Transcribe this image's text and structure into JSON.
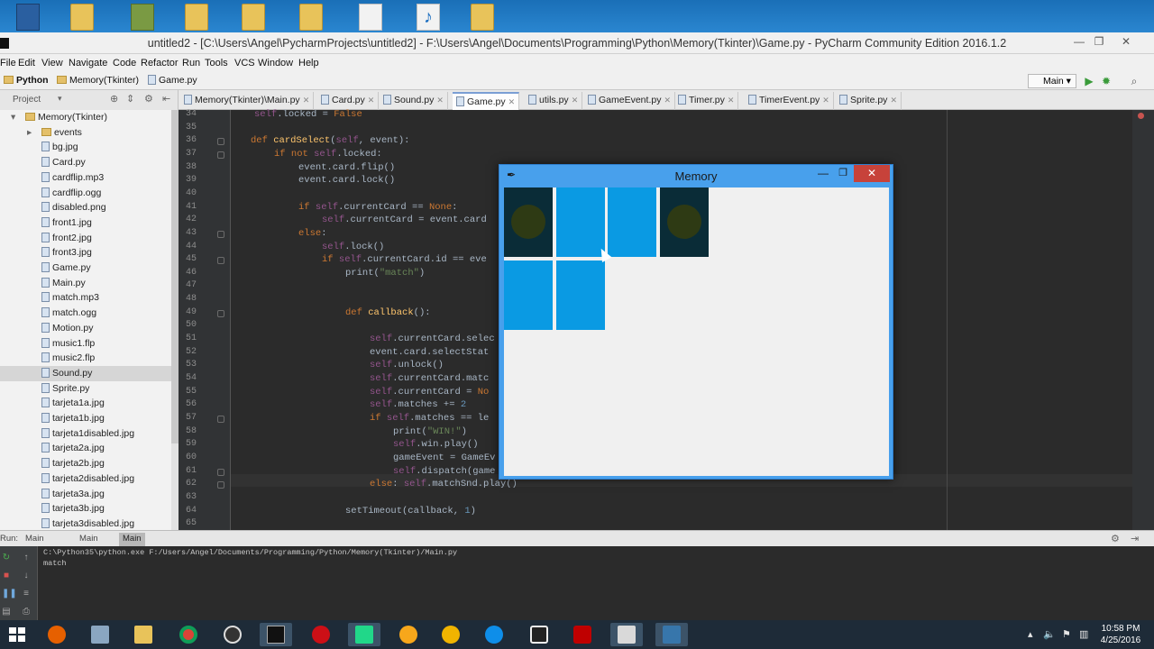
{
  "window": {
    "title": "untitled2 - [C:\\Users\\Angel\\PycharmProjects\\untitled2] - F:\\Users\\Angel\\Documents\\Programming\\Python\\Memory(Tkinter)\\Game.py - PyCharm Community Edition 2016.1.2"
  },
  "menu": [
    "File",
    "Edit",
    "View",
    "Navigate",
    "Code",
    "Refactor",
    "Run",
    "Tools",
    "VCS",
    "Window",
    "Help"
  ],
  "breadcrumb": [
    "Python",
    "Memory(Tkinter)",
    "Game.py"
  ],
  "run_config": "Main",
  "project_label": "Project",
  "tabs": [
    "Memory(Tkinter)\\Main.py",
    "Card.py",
    "Sound.py",
    "Game.py",
    "utils.py",
    "GameEvent.py",
    "Timer.py",
    "TimerEvent.py",
    "Sprite.py"
  ],
  "active_tab": "Game.py",
  "tree": {
    "root": "Memory(Tkinter)",
    "items": [
      "events",
      "bg.jpg",
      "Card.py",
      "cardflip.mp3",
      "cardflip.ogg",
      "disabled.png",
      "front1.jpg",
      "front2.jpg",
      "front3.jpg",
      "Game.py",
      "Main.py",
      "match.mp3",
      "match.ogg",
      "Motion.py",
      "music1.flp",
      "music2.flp",
      "Sound.py",
      "Sprite.py",
      "tarjeta1a.jpg",
      "tarjeta1b.jpg",
      "tarjeta1disabled.jpg",
      "tarjeta2a.jpg",
      "tarjeta2b.jpg",
      "tarjeta2disabled.jpg",
      "tarjeta3a.jpg",
      "tarjeta3b.jpg",
      "tarjeta3disabled.jpg"
    ],
    "selected": "Sound.py"
  },
  "line_numbers": [
    "34",
    "35",
    "36",
    "37",
    "38",
    "39",
    "40",
    "41",
    "42",
    "43",
    "44",
    "45",
    "46",
    "47",
    "48",
    "49",
    "50",
    "51",
    "52",
    "53",
    "54",
    "55",
    "56",
    "57",
    "58",
    "59",
    "60",
    "61",
    "62",
    "63",
    "64",
    "65"
  ],
  "run_panel": {
    "label": "Run:",
    "tabs": [
      "Main",
      "Main",
      "Main"
    ],
    "command": "C:\\Python35\\python.exe F:/Users/Angel/Documents/Programming/Python/Memory(Tkinter)/Main.py",
    "output": "match"
  },
  "tk_window": {
    "title": "Memory",
    "cards_state": [
      "front",
      "back",
      "back",
      "front",
      "back",
      "back"
    ]
  },
  "clock": {
    "time": "10:58 PM",
    "date": "4/25/2016"
  },
  "colors": {
    "card_back": "#0a9ae3",
    "card_front": "#0a2c37",
    "keyword": "#cc7832",
    "string": "#6a8759",
    "self": "#94558d"
  }
}
